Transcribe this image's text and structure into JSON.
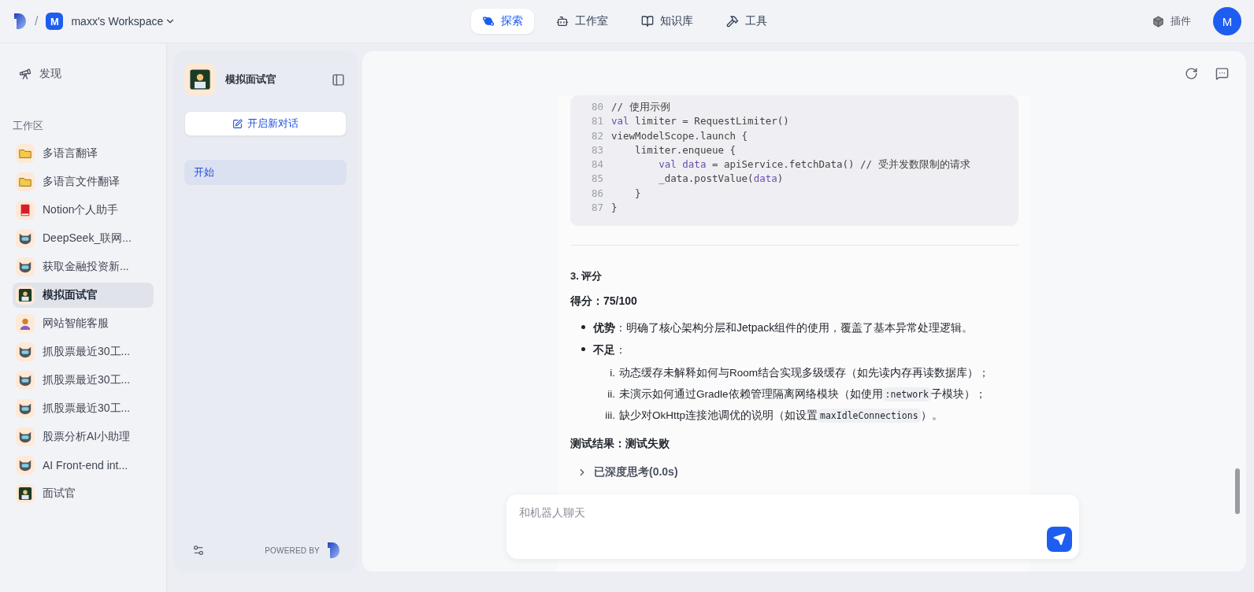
{
  "header": {
    "separator": "/",
    "workspace_initial": "M",
    "workspace_name": "maxx's Workspace",
    "nav": [
      {
        "label": "探索",
        "kind": "planet",
        "selected": true
      },
      {
        "label": "工作室",
        "kind": "bot",
        "selected": false
      },
      {
        "label": "知识库",
        "kind": "book",
        "selected": false
      },
      {
        "label": "工具",
        "kind": "hammer",
        "selected": false
      }
    ],
    "plugins_label": "插件",
    "avatar_initial": "M"
  },
  "sidebar": {
    "discover": "发现",
    "section_title": "工作区",
    "items": [
      {
        "label": "多语言翻译",
        "kind": "folder",
        "selected": false
      },
      {
        "label": "多语言文件翻译",
        "kind": "folder",
        "selected": false
      },
      {
        "label": "Notion个人助手",
        "kind": "book",
        "selected": false
      },
      {
        "label": "DeepSeek_联网...",
        "kind": "robot",
        "selected": false
      },
      {
        "label": "获取金融投资新...",
        "kind": "robot",
        "selected": false
      },
      {
        "label": "模拟面试官",
        "kind": "coder",
        "selected": true
      },
      {
        "label": "网站智能客服",
        "kind": "agent",
        "selected": false
      },
      {
        "label": "抓股票最近30工...",
        "kind": "robot",
        "selected": false
      },
      {
        "label": "抓股票最近30工...",
        "kind": "robot",
        "selected": false
      },
      {
        "label": "抓股票最近30工...",
        "kind": "robot",
        "selected": false
      },
      {
        "label": "股票分析AI小助理",
        "kind": "robot",
        "selected": false
      },
      {
        "label": "AI Front-end int...",
        "kind": "robot",
        "selected": false
      },
      {
        "label": "面试官",
        "kind": "coder",
        "selected": false
      }
    ]
  },
  "chat_panel": {
    "title": "模拟面试官",
    "new_chat": "开启新对话",
    "conversations": [
      {
        "label": "开始",
        "selected": true
      }
    ],
    "powered_by": "POWERED BY"
  },
  "message": {
    "code_lines": [
      {
        "num": "80",
        "segments": [
          {
            "text": "// 使用示例",
            "kind": "plain"
          }
        ]
      },
      {
        "num": "81",
        "segments": [
          {
            "text": "val",
            "kind": "keyword"
          },
          {
            "text": " limiter = RequestLimiter()",
            "kind": "plain"
          }
        ]
      },
      {
        "num": "82",
        "segments": [
          {
            "text": "viewModelScope.launch {",
            "kind": "plain"
          }
        ]
      },
      {
        "num": "83",
        "segments": [
          {
            "text": "    limiter.enqueue {",
            "kind": "plain"
          }
        ]
      },
      {
        "num": "84",
        "segments": [
          {
            "text": "        val data",
            "kind": "keyword"
          },
          {
            "text": " = apiService.fetchData() // 受并发数限制的请求",
            "kind": "plain"
          }
        ]
      },
      {
        "num": "85",
        "segments": [
          {
            "text": "        _data.postValue(",
            "kind": "plain"
          },
          {
            "text": "data",
            "kind": "keyword"
          },
          {
            "text": ")",
            "kind": "plain"
          }
        ]
      },
      {
        "num": "86",
        "segments": [
          {
            "text": "    }",
            "kind": "plain"
          }
        ]
      },
      {
        "num": "87",
        "segments": [
          {
            "text": "}",
            "kind": "plain"
          }
        ]
      }
    ],
    "heading": "3. 评分",
    "score": "得分：75/100",
    "bullets": [
      {
        "text": "**优势**：明确了核心架构分层和Jetpack组件的使用，覆盖了基本异常处理逻辑。"
      },
      {
        "text": "**不足**：",
        "children": [
          {
            "marker": "i.",
            "segments": [
              {
                "text": "动态缓存未解释如何与Room结合实现多级缓存（如先读内存再读数据库）；",
                "kind": "plain"
              }
            ]
          },
          {
            "marker": "ii.",
            "segments": [
              {
                "text": "未演示如何通过Gradle依赖管理隔离网络模块（如使用",
                "kind": "plain"
              },
              {
                "text": ":network",
                "kind": "code"
              },
              {
                "text": "子模块）；",
                "kind": "plain"
              }
            ]
          },
          {
            "marker": "iii.",
            "segments": [
              {
                "text": "缺少对OkHttp连接池调优的说明（如设置",
                "kind": "plain"
              },
              {
                "text": "maxIdleConnections",
                "kind": "code"
              },
              {
                "text": "）。",
                "kind": "plain"
              }
            ]
          }
        ]
      }
    ],
    "result": "测试结果：测试失败",
    "thinking": "已深度思考(0.0s)",
    "thinking_expanded": false
  },
  "input": {
    "placeholder": "和机器人聊天"
  }
}
